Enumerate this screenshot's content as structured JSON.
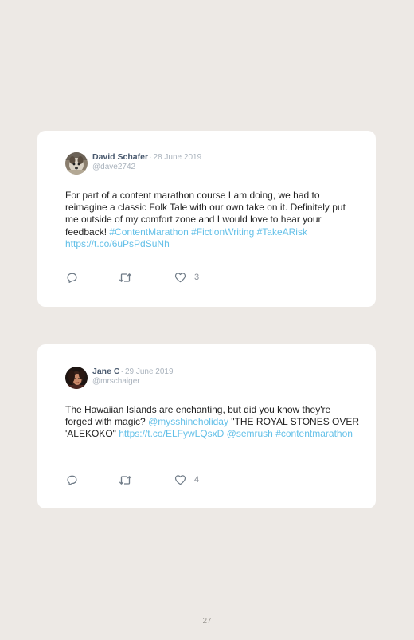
{
  "tweets": [
    {
      "name": "David Schafer",
      "separator": "·",
      "date": "28 June 2019",
      "handle": "@dave2742",
      "text": [
        {
          "t": "For part of a content marathon course I am doing, we had to reimagine a classic Folk Tale with our own take on it. Definitely put me outside of my comfort zone and I would love to hear your feedback! ",
          "link": false
        },
        {
          "t": "#ContentMarathon",
          "link": true
        },
        {
          "t": " ",
          "link": false
        },
        {
          "t": "#FictionWriting",
          "link": true
        },
        {
          "t": " ",
          "link": false
        },
        {
          "t": "#TakeARisk",
          "link": true
        },
        {
          "t": " ",
          "link": false
        },
        {
          "t": "https://t.co/6uPsPdSuNh",
          "link": true
        }
      ],
      "likes": "3",
      "avatar": "dog-photo"
    },
    {
      "name": "Jane C",
      "separator": "·",
      "date": "29 June 2019",
      "handle": "@mrschaiger",
      "text": [
        {
          "t": "The Hawaiian Islands are enchanting, but did you know they're forged with magic? ",
          "link": false
        },
        {
          "t": "@mysshineholiday",
          "link": true
        },
        {
          "t": " \"THE ROYAL STONES OVER 'ALEKOKO\" ",
          "link": false
        },
        {
          "t": "https://t.co/ELFywLQsxD",
          "link": true
        },
        {
          "t": " ",
          "link": false
        },
        {
          "t": "@semrush",
          "link": true
        },
        {
          "t": " ",
          "link": false
        },
        {
          "t": "#contentmarathon",
          "link": true
        }
      ],
      "likes": "4",
      "avatar": "woman-photo"
    }
  ],
  "colors": {
    "page_background": "#ede9e5",
    "card_background": "#ffffff",
    "name": "#4a5a6f",
    "meta": "#aab3bd",
    "link": "#64c0e8",
    "body_text": "#222222",
    "icon": "#6f7b87"
  },
  "icons": [
    "reply-icon",
    "retweet-icon",
    "heart-icon"
  ],
  "page_number": "27"
}
